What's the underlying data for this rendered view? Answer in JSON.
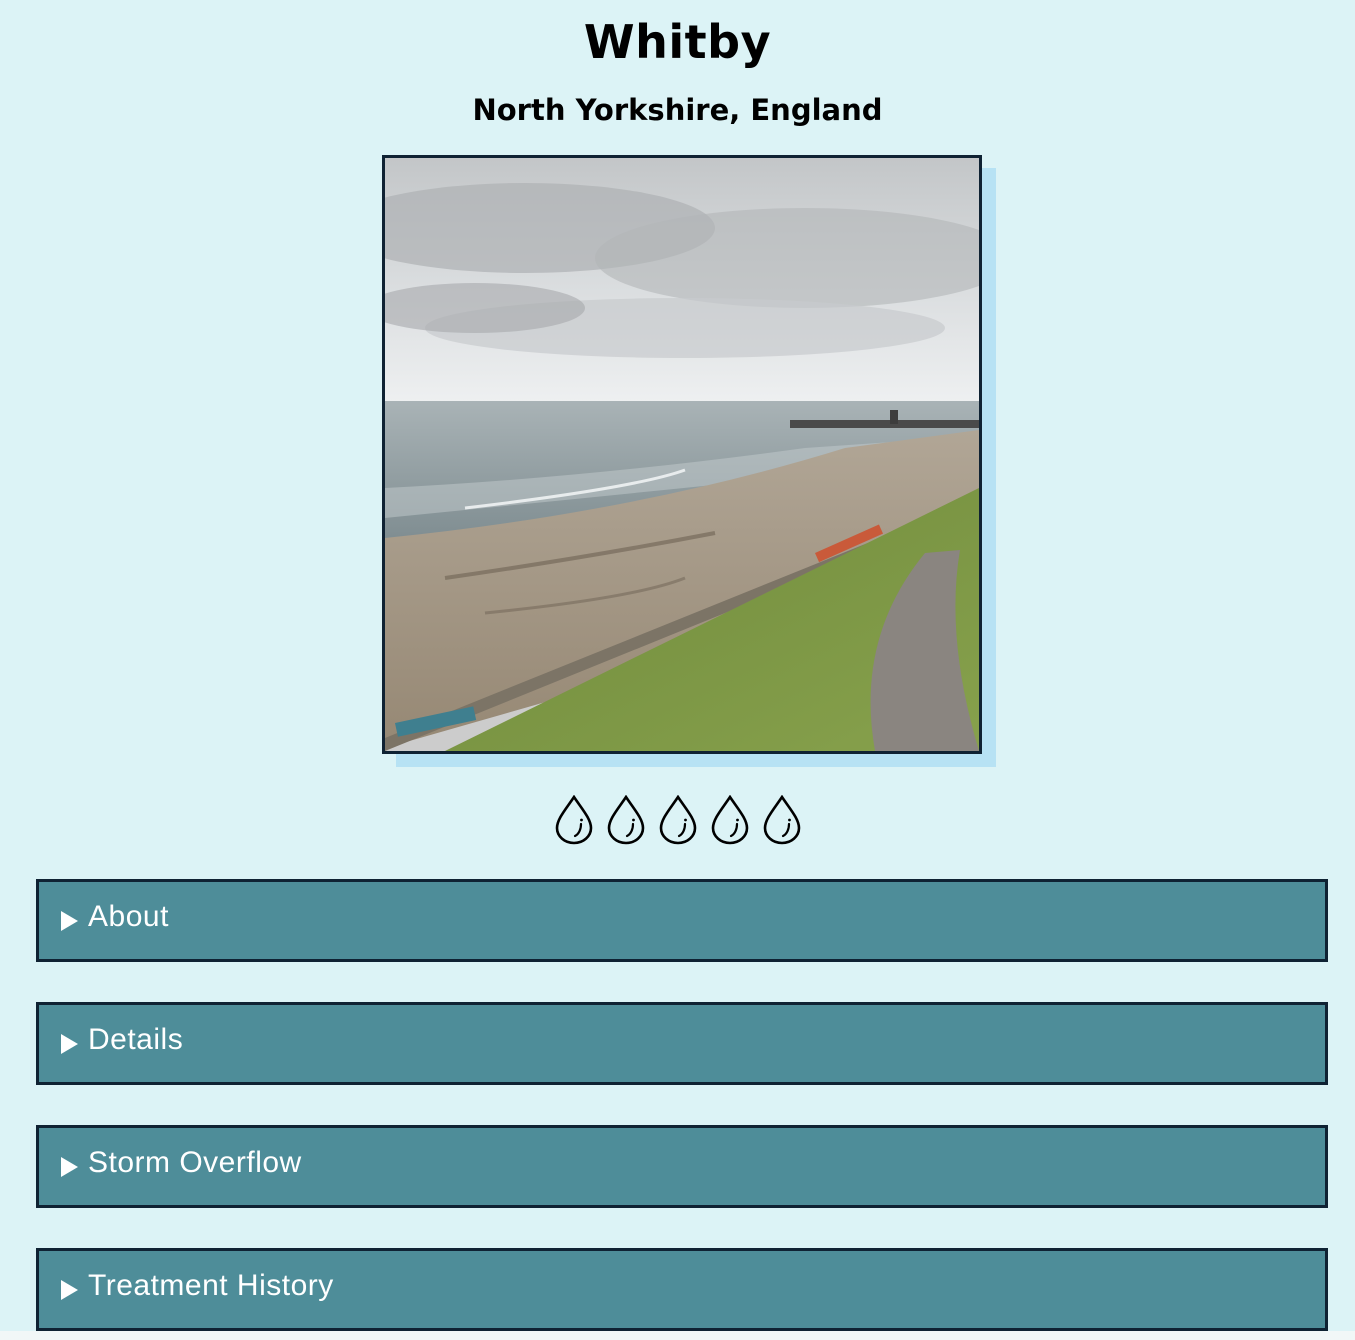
{
  "beach": {
    "name": "Whitby",
    "region": "North Yorkshire, England"
  },
  "rating": {
    "icon": "water-drop-icon",
    "count": 5
  },
  "sections": [
    {
      "label": "About"
    },
    {
      "label": "Details"
    },
    {
      "label": "Storm Overflow"
    },
    {
      "label": "Treatment History"
    }
  ],
  "colors": {
    "background": "#dcf3f6",
    "accordion": "#4e8d99",
    "border": "#0f2233",
    "shadow": "#b7e2f4"
  }
}
